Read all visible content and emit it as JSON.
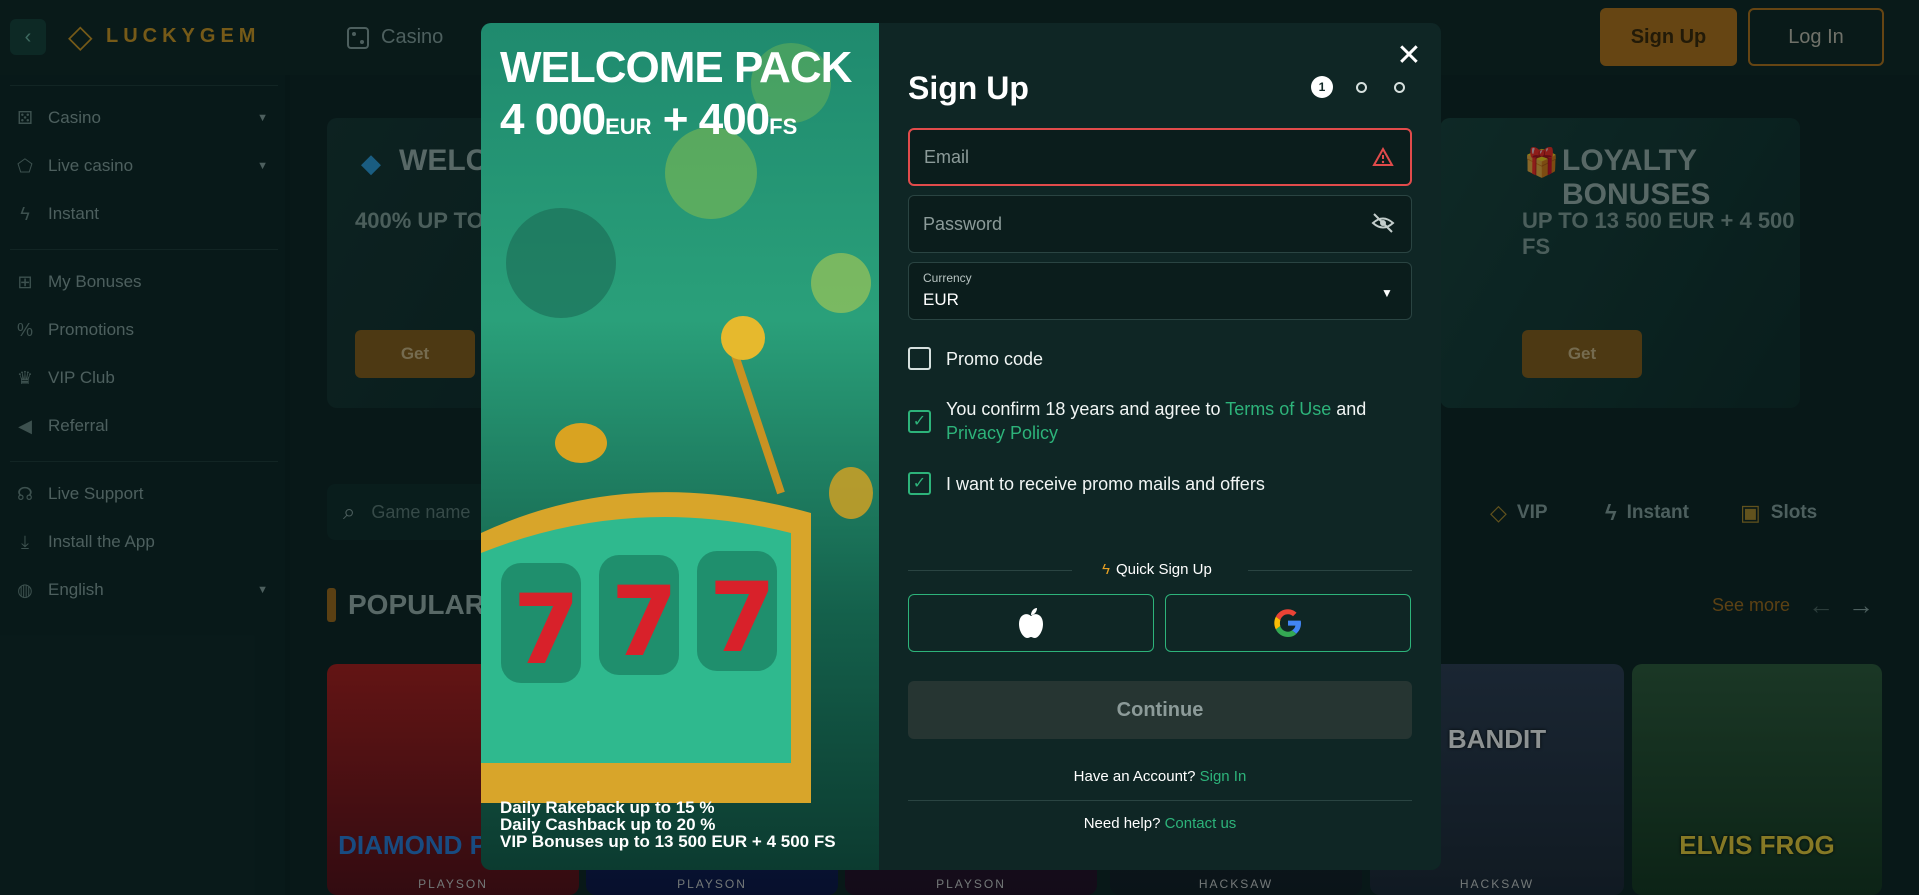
{
  "header": {
    "brand": "LUCKYGEM",
    "nav_casino": "Casino",
    "signup_label": "Sign Up",
    "login_label": "Log In"
  },
  "sidebar": {
    "items": [
      {
        "label": "Casino",
        "icon": "dice-icon"
      },
      {
        "label": "Live casino",
        "icon": "live-icon"
      },
      {
        "label": "Instant",
        "icon": "lightning-icon"
      },
      {
        "label": "My Bonuses",
        "icon": "gift-icon"
      },
      {
        "label": "Promotions",
        "icon": "percent-icon"
      },
      {
        "label": "VIP Club",
        "icon": "crown-icon"
      },
      {
        "label": "Referral",
        "icon": "megaphone-icon"
      },
      {
        "label": "Live Support",
        "icon": "headset-icon"
      },
      {
        "label": "Install the App",
        "icon": "download-icon"
      },
      {
        "label": "English",
        "icon": "globe-icon"
      }
    ]
  },
  "promos": [
    {
      "title": "WELC",
      "subtitle": "400% UP TO",
      "button": "Get"
    },
    {
      "title": "LOYALTY BONUSES",
      "subtitle": "UP TO 13 500 EUR + 4 500 FS",
      "button": "Get"
    }
  ],
  "search": {
    "placeholder": "Game name"
  },
  "categories": [
    {
      "label": "VIP",
      "icon": "diamond-icon"
    },
    {
      "label": "Instant",
      "icon": "lightning-icon"
    },
    {
      "label": "Slots",
      "icon": "slot-icon"
    }
  ],
  "popular": {
    "title": "POPULAR",
    "see_more": "See more"
  },
  "games": [
    {
      "title": "DIAMOND POWER",
      "provider": "PLAYSON"
    },
    {
      "title": "",
      "provider": "PLAYSON"
    },
    {
      "title": "",
      "provider": "PLAYSON"
    },
    {
      "title": "",
      "provider": "HACKSAW"
    },
    {
      "title": "BANDIT",
      "provider": "HACKSAW"
    },
    {
      "title": "ELVIS FROG",
      "provider": ""
    }
  ],
  "modal": {
    "promo": {
      "title": "WELCOME PACK",
      "amount_main": "4 000",
      "amount_unit": "EUR",
      "amount_plus": "+ 400",
      "amount_unit2": "FS",
      "perks": [
        "Daily Rakeback up to 15 %",
        "Daily Cashback up to 20 %",
        "VIP Bonuses up to 13 500 EUR + 4 500 FS"
      ]
    },
    "title": "Sign Up",
    "steps": [
      "1",
      "",
      ""
    ],
    "email_placeholder": "Email",
    "password_placeholder": "Password",
    "currency_label": "Currency",
    "currency_value": "EUR",
    "promo_code_label": "Promo code",
    "terms_prefix": "You confirm 18 years and agree to ",
    "terms_link": "Terms of Use",
    "terms_and": " and",
    "privacy_link": "Privacy Policy",
    "mails_label": "I want to receive promo mails and offers",
    "quick_signup": "Quick Sign Up",
    "continue_label": "Continue",
    "have_account": "Have an Account?",
    "sign_in": "Sign In",
    "need_help": "Need help?",
    "contact_us": "Contact us",
    "colors": {
      "accent_green": "#2db37a",
      "accent_gold": "#b87418",
      "error_red": "#e14b4b"
    }
  }
}
